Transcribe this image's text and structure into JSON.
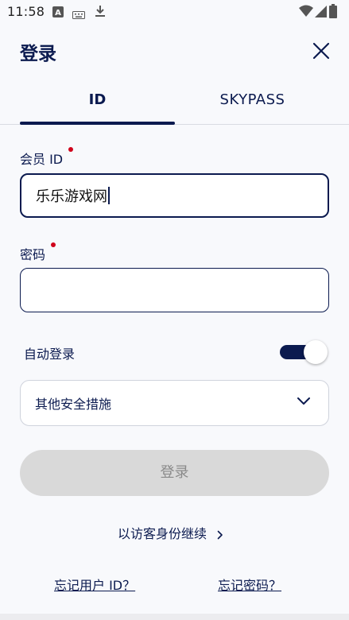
{
  "status_bar": {
    "time": "11:58",
    "icons": [
      "text-a-icon",
      "keyboard-icon",
      "download-icon",
      "wifi-icon",
      "signal-icon",
      "battery-icon"
    ]
  },
  "header": {
    "title": "登录",
    "close_icon": "close-icon"
  },
  "tabs": [
    {
      "label": "ID",
      "selected": true
    },
    {
      "label": "SKYPASS",
      "selected": false
    }
  ],
  "form": {
    "member_id": {
      "label": "会员 ID",
      "value": "乐乐游戏网",
      "required": true
    },
    "password": {
      "label": "密码",
      "value": "",
      "required": true
    },
    "auto_login": {
      "label": "自动登录",
      "on": true
    },
    "security": {
      "label": "其他安全措施"
    },
    "login_button": "登录"
  },
  "guest_link": "以访客身份继续",
  "forgot_id": "忘记用户 ID？",
  "forgot_password": "忘记密码？",
  "colors": {
    "brand_navy": "#0b1a4f",
    "required_dot": "#d0021b",
    "disabled_button": "#d9d9d9"
  }
}
